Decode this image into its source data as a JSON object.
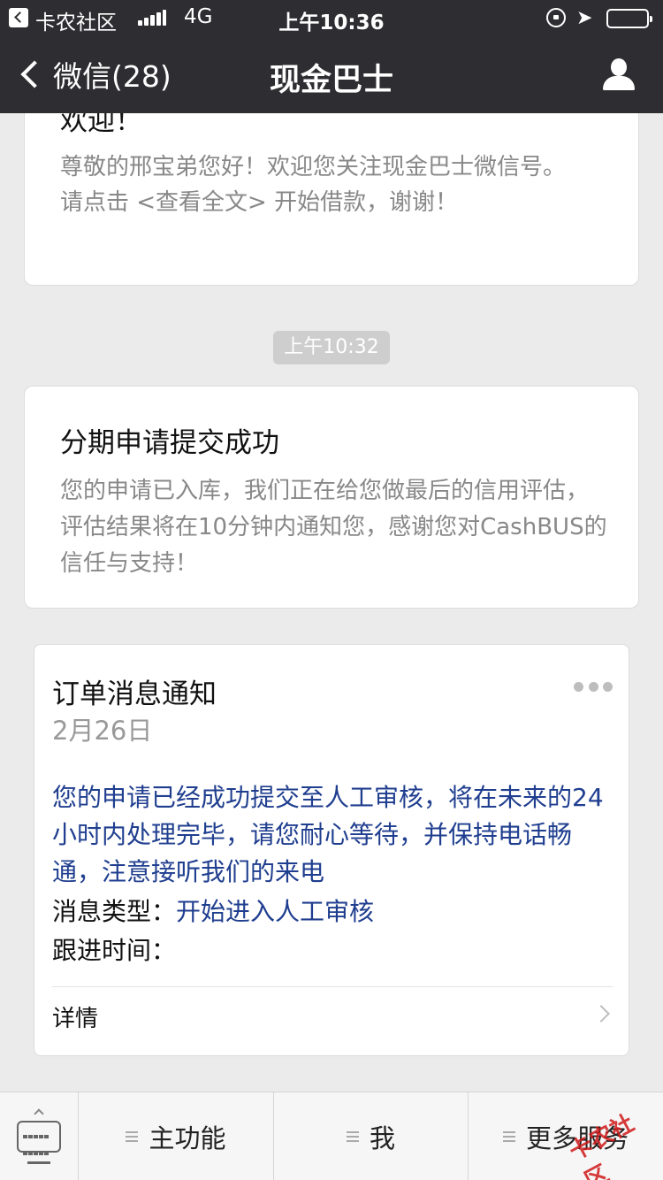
{
  "status_bar": {
    "carrier": "卡农社区",
    "network": "4G",
    "time": "上午10:36"
  },
  "nav": {
    "back_label": "微信(28)",
    "title": "现金巴士"
  },
  "messages": {
    "welcome": {
      "heading": "欢迎！",
      "body": "尊敬的邢宝弟您好！欢迎您关注现金巴士微信号。\n请点击 <查看全文> 开始借款，谢谢！"
    },
    "timestamp": "上午10:32",
    "submit_success": {
      "heading": "分期申请提交成功",
      "body": "您的申请已入库，我们正在给您做最后的信用评估，评估结果将在10分钟内通知您，感谢您对CashBUS的信任与支持！"
    },
    "order_notice": {
      "heading": "订单消息通知",
      "date": "2月26日",
      "message": "您的申请已经成功提交至人工审核，将在未来的24小时内处理完毕，请您耐心等待，并保持电话畅通，注意接听我们的来电",
      "type_label": "消息类型：",
      "type_value": "开始进入人工审核",
      "followup_label": "跟进时间：",
      "detail_label": "详情"
    }
  },
  "bottom_menu": {
    "items": [
      "主功能",
      "我",
      "更多服务"
    ]
  },
  "watermark": "卡农社区",
  "colors": {
    "nav_bg": "#2e2e32",
    "chat_bg": "#ebebeb",
    "link_blue": "#1f3e8f"
  }
}
